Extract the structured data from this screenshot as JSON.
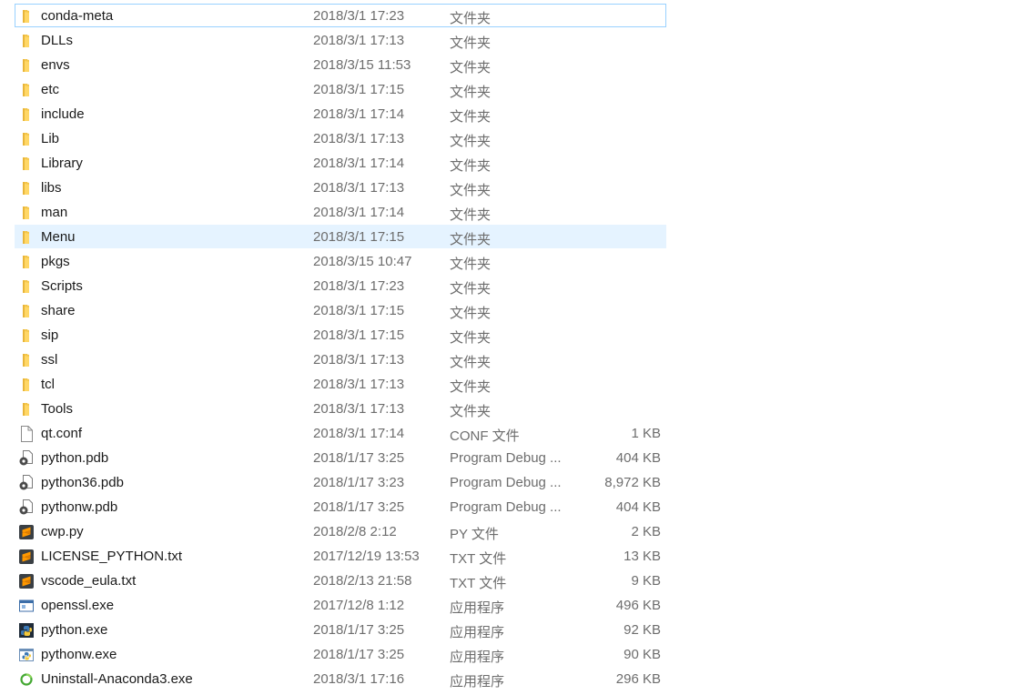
{
  "files": [
    {
      "name": "conda-meta",
      "date": "2018/3/1 17:23",
      "type": "文件夹",
      "size": "",
      "icon": "folder-icon",
      "state": "focused"
    },
    {
      "name": "DLLs",
      "date": "2018/3/1 17:13",
      "type": "文件夹",
      "size": "",
      "icon": "folder-icon"
    },
    {
      "name": "envs",
      "date": "2018/3/15 11:53",
      "type": "文件夹",
      "size": "",
      "icon": "folder-icon"
    },
    {
      "name": "etc",
      "date": "2018/3/1 17:15",
      "type": "文件夹",
      "size": "",
      "icon": "folder-icon"
    },
    {
      "name": "include",
      "date": "2018/3/1 17:14",
      "type": "文件夹",
      "size": "",
      "icon": "folder-icon"
    },
    {
      "name": "Lib",
      "date": "2018/3/1 17:13",
      "type": "文件夹",
      "size": "",
      "icon": "folder-icon"
    },
    {
      "name": "Library",
      "date": "2018/3/1 17:14",
      "type": "文件夹",
      "size": "",
      "icon": "folder-icon"
    },
    {
      "name": "libs",
      "date": "2018/3/1 17:13",
      "type": "文件夹",
      "size": "",
      "icon": "folder-icon"
    },
    {
      "name": "man",
      "date": "2018/3/1 17:14",
      "type": "文件夹",
      "size": "",
      "icon": "folder-icon"
    },
    {
      "name": "Menu",
      "date": "2018/3/1 17:15",
      "type": "文件夹",
      "size": "",
      "icon": "folder-icon",
      "state": "hovered"
    },
    {
      "name": "pkgs",
      "date": "2018/3/15 10:47",
      "type": "文件夹",
      "size": "",
      "icon": "folder-icon"
    },
    {
      "name": "Scripts",
      "date": "2018/3/1 17:23",
      "type": "文件夹",
      "size": "",
      "icon": "folder-icon"
    },
    {
      "name": "share",
      "date": "2018/3/1 17:15",
      "type": "文件夹",
      "size": "",
      "icon": "folder-icon"
    },
    {
      "name": "sip",
      "date": "2018/3/1 17:15",
      "type": "文件夹",
      "size": "",
      "icon": "folder-icon"
    },
    {
      "name": "ssl",
      "date": "2018/3/1 17:13",
      "type": "文件夹",
      "size": "",
      "icon": "folder-icon"
    },
    {
      "name": "tcl",
      "date": "2018/3/1 17:13",
      "type": "文件夹",
      "size": "",
      "icon": "folder-icon"
    },
    {
      "name": "Tools",
      "date": "2018/3/1 17:13",
      "type": "文件夹",
      "size": "",
      "icon": "folder-icon"
    },
    {
      "name": "qt.conf",
      "date": "2018/3/1 17:14",
      "type": "CONF 文件",
      "size": "1 KB",
      "icon": "blank-file-icon"
    },
    {
      "name": "python.pdb",
      "date": "2018/1/17 3:25",
      "type": "Program Debug ...",
      "size": "404 KB",
      "icon": "debug-file-icon"
    },
    {
      "name": "python36.pdb",
      "date": "2018/1/17 3:23",
      "type": "Program Debug ...",
      "size": "8,972 KB",
      "icon": "debug-file-icon"
    },
    {
      "name": "pythonw.pdb",
      "date": "2018/1/17 3:25",
      "type": "Program Debug ...",
      "size": "404 KB",
      "icon": "debug-file-icon"
    },
    {
      "name": "cwp.py",
      "date": "2018/2/8 2:12",
      "type": "PY 文件",
      "size": "2 KB",
      "icon": "sublime-text-icon"
    },
    {
      "name": "LICENSE_PYTHON.txt",
      "date": "2017/12/19 13:53",
      "type": "TXT 文件",
      "size": "13 KB",
      "icon": "sublime-text-icon"
    },
    {
      "name": "vscode_eula.txt",
      "date": "2018/2/13 21:58",
      "type": "TXT 文件",
      "size": "9 KB",
      "icon": "sublime-text-icon"
    },
    {
      "name": "openssl.exe",
      "date": "2017/12/8 1:12",
      "type": "应用程序",
      "size": "496 KB",
      "icon": "application-window-icon"
    },
    {
      "name": "python.exe",
      "date": "2018/1/17 3:25",
      "type": "应用程序",
      "size": "92 KB",
      "icon": "python-console-icon"
    },
    {
      "name": "pythonw.exe",
      "date": "2018/1/17 3:25",
      "type": "应用程序",
      "size": "90 KB",
      "icon": "python-window-icon"
    },
    {
      "name": "Uninstall-Anaconda3.exe",
      "date": "2018/3/1 17:16",
      "type": "应用程序",
      "size": "296 KB",
      "icon": "anaconda-ring-icon"
    }
  ]
}
